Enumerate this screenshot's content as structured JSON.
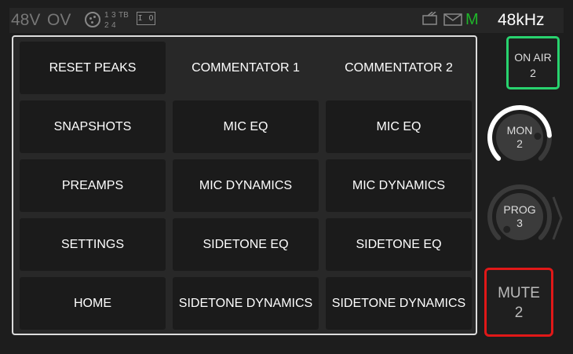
{
  "status": {
    "phantom": "48V",
    "overload": "OV",
    "channel_grid": [
      "1",
      "3",
      "TB",
      "2",
      "4",
      ""
    ],
    "io_label": "I O",
    "m_label": "M",
    "sample_rate": "48kHz"
  },
  "colors": {
    "on_air_border": "#28d26e",
    "mute_border": "#e11818",
    "m_indicator": "#1fb52a"
  },
  "grid": {
    "rows": [
      [
        "RESET PEAKS",
        "COMMENTATOR 1",
        "COMMENTATOR 2"
      ],
      [
        "SNAPSHOTS",
        "MIC EQ",
        "MIC EQ"
      ],
      [
        "PREAMPS",
        "MIC DYNAMICS",
        "MIC DYNAMICS"
      ],
      [
        "SETTINGS",
        "SIDETONE EQ",
        "SIDETONE EQ"
      ],
      [
        "HOME",
        "SIDETONE DYNAMICS",
        "SIDETONE DYNAMICS"
      ]
    ]
  },
  "on_air": {
    "label": "ON AIR",
    "value": "2"
  },
  "mon": {
    "label": "MON",
    "value": "2",
    "level": 0.82
  },
  "prog": {
    "label": "PROG",
    "value": "3",
    "level": 0.0
  },
  "mute": {
    "label": "MUTE",
    "value": "2"
  },
  "icons": {
    "connector": "xlr-connector-icon",
    "io": "io-box-icon",
    "router": "router-icon",
    "mail": "mail-icon",
    "next": "chevron-right-icon"
  }
}
